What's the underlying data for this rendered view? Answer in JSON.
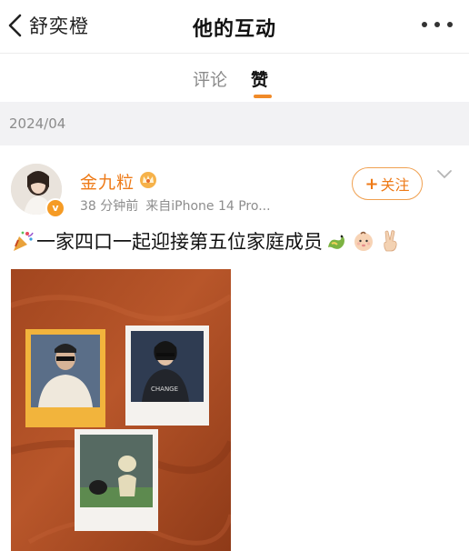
{
  "nav": {
    "back_label": "舒奕橙",
    "title": "他的互动"
  },
  "tabs": [
    {
      "label": "评论",
      "active": false
    },
    {
      "label": "赞",
      "active": true
    }
  ],
  "section_date": "2024/04",
  "post": {
    "author": "金九粒",
    "time": "38 分钟前",
    "source": "来自iPhone 14 Pro...",
    "follow_label": "关注",
    "text": "一家四口一起迎接第五位家庭成员",
    "emojis": [
      "party-popper",
      "dragon",
      "baby-face",
      "peace-hand"
    ]
  },
  "colors": {
    "accent": "#ee7a17",
    "tab_indicator": "#f08a28",
    "band": "#f2f2f4"
  }
}
